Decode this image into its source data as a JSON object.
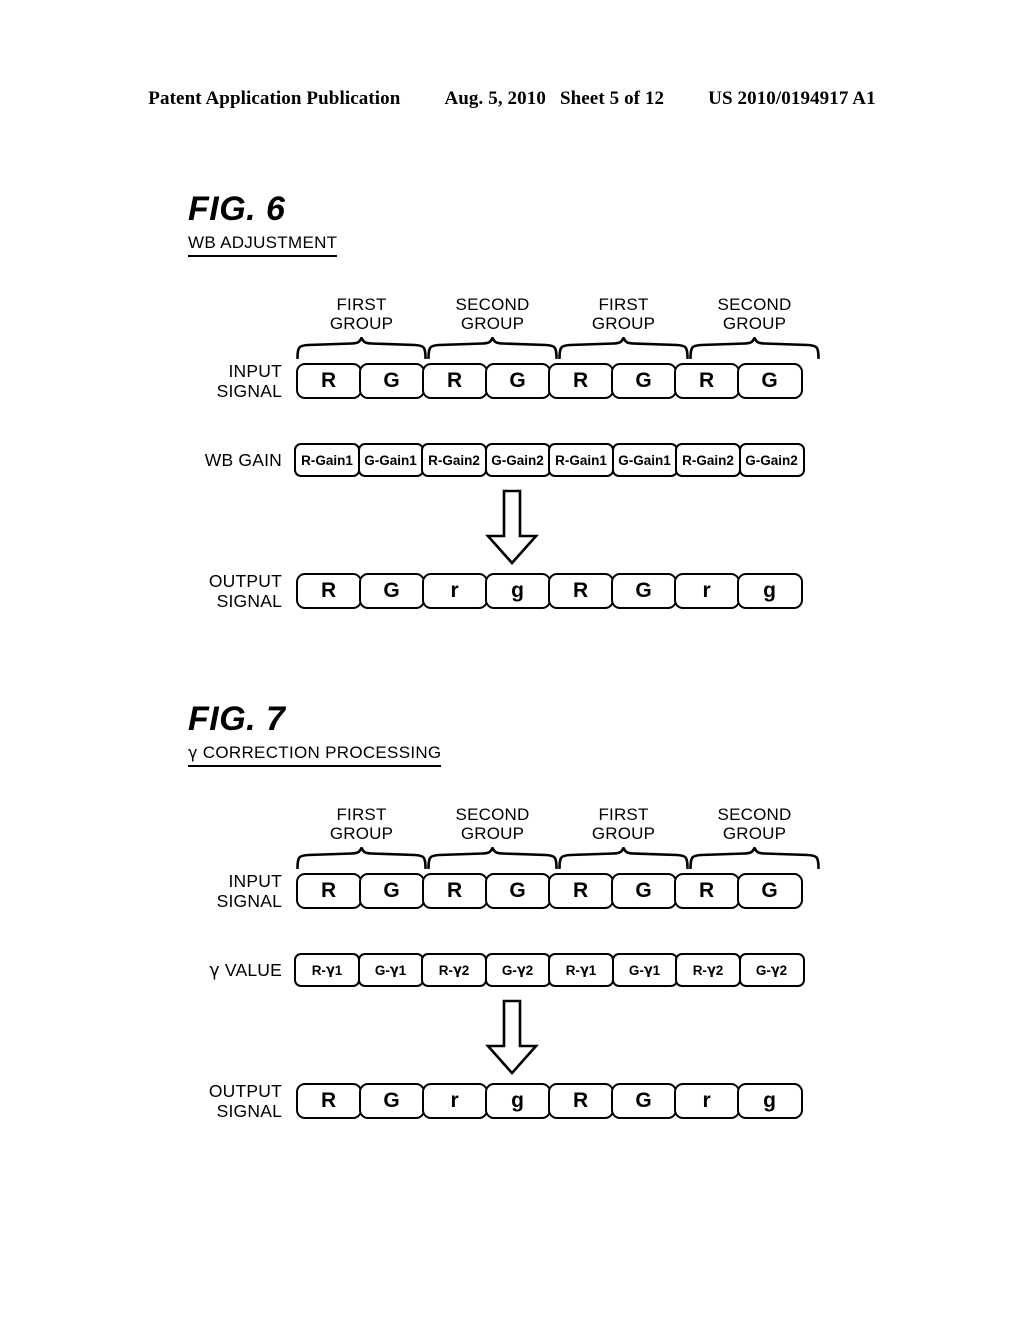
{
  "header": {
    "publication": "Patent Application Publication",
    "date": "Aug. 5, 2010",
    "sheet": "Sheet 5 of 12",
    "doc_number": "US 2010/0194917 A1"
  },
  "figures": [
    {
      "id": "fig6",
      "label": "FIG. 6",
      "caption": "WB ADJUSTMENT",
      "group_labels": [
        {
          "line1": "FIRST",
          "line2": "GROUP"
        },
        {
          "line1": "SECOND",
          "line2": "GROUP"
        },
        {
          "line1": "FIRST",
          "line2": "GROUP"
        },
        {
          "line1": "SECOND",
          "line2": "GROUP"
        }
      ],
      "rows": [
        {
          "label_line1": "INPUT",
          "label_line2": "SIGNAL",
          "style": "large",
          "cells": [
            "R",
            "G",
            "R",
            "G",
            "R",
            "G",
            "R",
            "G"
          ]
        },
        {
          "label_line1": "WB GAIN",
          "label_line2": "",
          "style": "small",
          "cells": [
            "R-Gain1",
            "G-Gain1",
            "R-Gain2",
            "G-Gain2",
            "R-Gain1",
            "G-Gain1",
            "R-Gain2",
            "G-Gain2"
          ]
        },
        {
          "label_line1": "OUTPUT",
          "label_line2": "SIGNAL",
          "style": "large",
          "cells": [
            "R",
            "G",
            "r",
            "g",
            "R",
            "G",
            "r",
            "g"
          ]
        }
      ],
      "arrow": "down-arrow-outline"
    },
    {
      "id": "fig7",
      "label": "FIG. 7",
      "caption": "γ CORRECTION PROCESSING",
      "group_labels": [
        {
          "line1": "FIRST",
          "line2": "GROUP"
        },
        {
          "line1": "SECOND",
          "line2": "GROUP"
        },
        {
          "line1": "FIRST",
          "line2": "GROUP"
        },
        {
          "line1": "SECOND",
          "line2": "GROUP"
        }
      ],
      "rows": [
        {
          "label_line1": "INPUT",
          "label_line2": "SIGNAL",
          "style": "large",
          "cells": [
            "R",
            "G",
            "R",
            "G",
            "R",
            "G",
            "R",
            "G"
          ]
        },
        {
          "label_line1": "γ VALUE",
          "label_line2": "",
          "style": "small",
          "cells": [
            "R-γ1",
            "G-γ1",
            "R-γ2",
            "G-γ2",
            "R-γ1",
            "G-γ1",
            "R-γ2",
            "G-γ2"
          ]
        },
        {
          "label_line1": "OUTPUT",
          "label_line2": "SIGNAL",
          "style": "large",
          "cells": [
            "R",
            "G",
            "r",
            "g",
            "R",
            "G",
            "r",
            "g"
          ]
        }
      ],
      "arrow": "down-arrow-outline"
    }
  ],
  "colors": {
    "ink": "#000000",
    "page": "#ffffff"
  }
}
